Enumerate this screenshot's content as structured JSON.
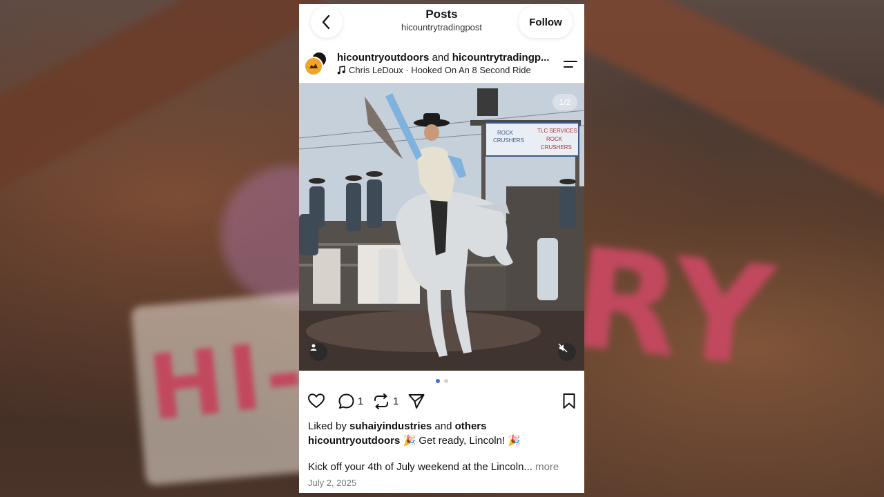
{
  "header": {
    "title": "Posts",
    "subtitle": "hicountrytradingpost",
    "follow_label": "Follow"
  },
  "post": {
    "author_primary": "hicountryoutdoors",
    "author_join": "and",
    "author_secondary": "hicountrytradingp...",
    "music": "Chris LeDoux · Hooked On An 8 Second Ride",
    "carousel_counter": "1/2",
    "carousel_index": 1,
    "carousel_total": 2,
    "comment_count": "1",
    "repost_count": "1",
    "liked_by_prefix": "Liked by",
    "liked_by_user": "suhaiyindustries",
    "liked_by_join": "and",
    "liked_by_others": "others",
    "caption_author": "hicountryoutdoors",
    "caption_first_line": "🎉 Get ready, Lincoln! 🎉",
    "caption_body": "Kick off your 4th of July weekend at the Lincoln...",
    "more_label": "more",
    "date": "July 2, 2025",
    "photo_sign": {
      "line1": "ROCK CRUSHERS",
      "line2": "TLC SERVICES ROCK CRUSHERS"
    }
  },
  "icons": {
    "back": "chevron-left-icon",
    "menu": "menu-lines-icon",
    "music": "music-note-icon",
    "like": "heart-icon",
    "comment": "comment-icon",
    "repost": "repost-icon",
    "share": "send-icon",
    "save": "bookmark-icon",
    "tag": "user-tag-icon",
    "mute": "muted-speaker-icon"
  },
  "colors": {
    "carousel_active": "#3d6dea",
    "avatar_brand": "#f2a42a"
  }
}
